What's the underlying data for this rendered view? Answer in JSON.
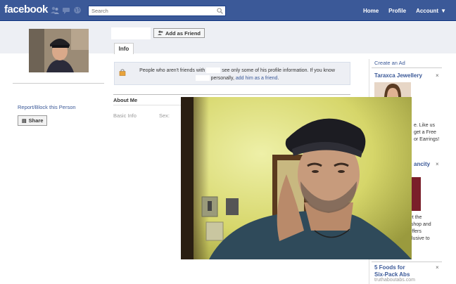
{
  "header": {
    "logo": "facebook",
    "search_placeholder": "Search",
    "nav": [
      "Home",
      "Profile",
      "Account"
    ]
  },
  "profile": {
    "add_friend_label": "Add as Friend",
    "tab_info": "Info",
    "report_link": "Report/Block this Person",
    "share_label": "Share"
  },
  "notice": {
    "part1": "People who aren't friends with",
    "part2": "see only some of his profile information. If you know",
    "part3": "personally,",
    "link": "add him as a friend",
    "end": "."
  },
  "about": {
    "heading": "About Me",
    "basic_info": "Basic Info",
    "sex_label": "Sex:"
  },
  "ads": {
    "create_ad": "Create an Ad",
    "ad1_title": "Taraxca Jewellery",
    "ad1_text": [
      "e. Like us",
      "get a Free",
      "or Earrings!"
    ],
    "ad2_title": "ancity",
    "ad2_text": [
      "get the",
      "e shop and",
      "l offers",
      "xclusive to"
    ],
    "ad3_title_lines": [
      "5 Foods for",
      "Six-Pack Abs"
    ],
    "ad3_url": "truthaboutabs.com",
    "close": "×"
  },
  "colors": {
    "brand_blue": "#3b5998",
    "header_gray": "#edeff4",
    "link": "#3b5998",
    "overlay_wall": "#d8d870"
  }
}
